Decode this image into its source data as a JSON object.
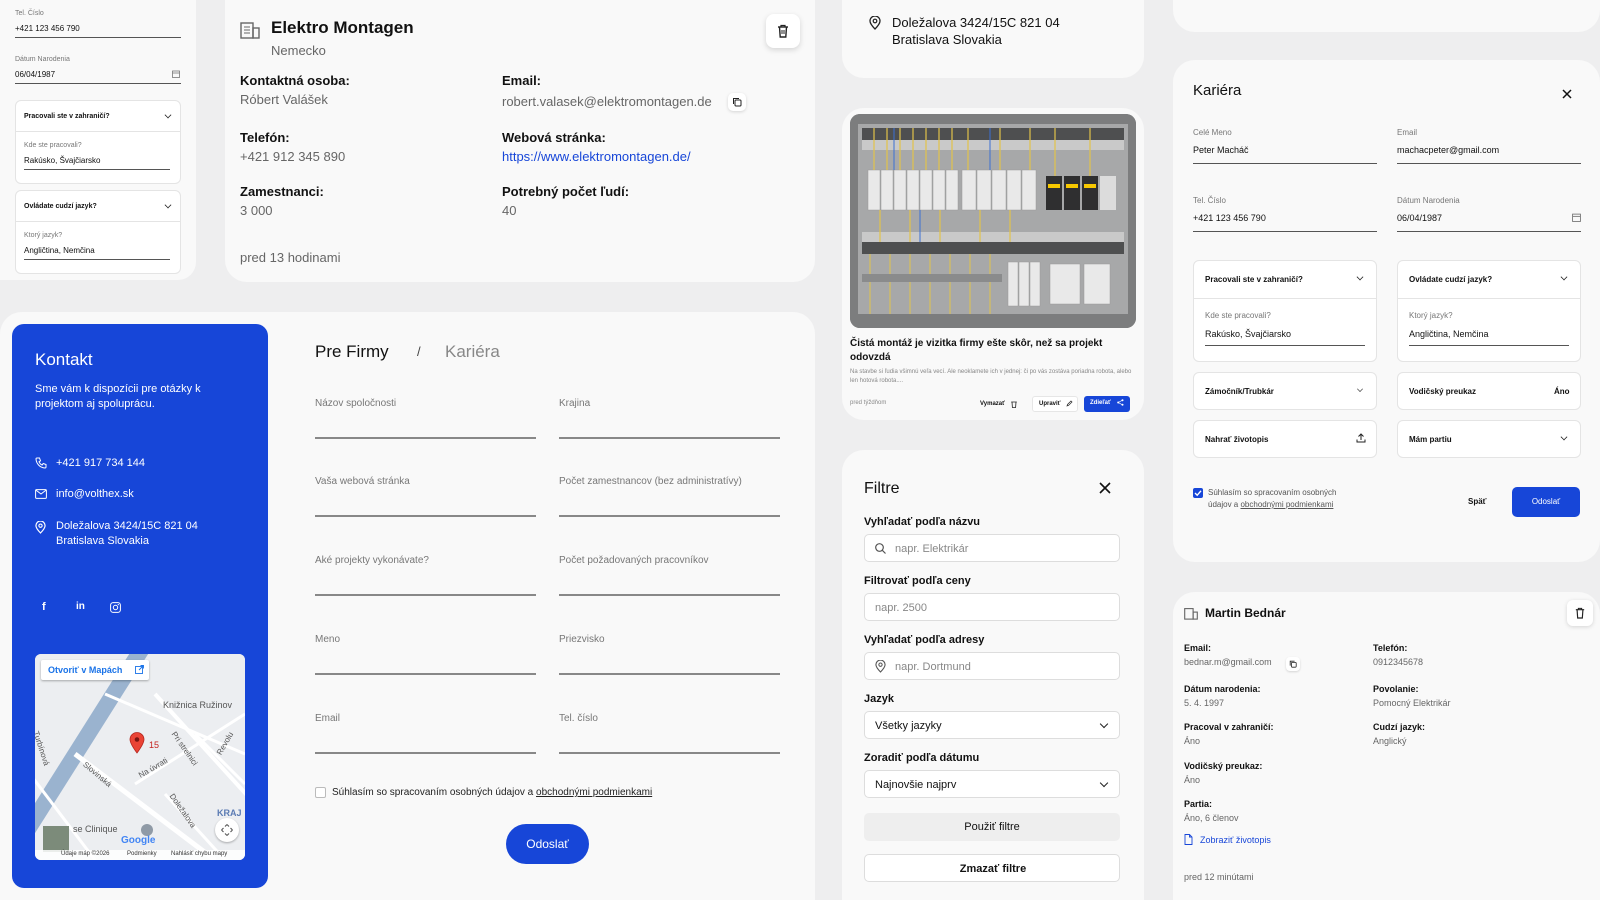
{
  "colors": {
    "primary": "#1746d8",
    "link": "#1746d8",
    "background": "#eeeeef",
    "card": "#f9f9f9"
  },
  "mini_form": {
    "phone_label": "Tel. Číslo",
    "phone_value": "+421 123 456 790",
    "birth_label": "Dátum Narodenia",
    "birth_value": "06/04/1987",
    "abroad_q": "Pracovali ste v zahraničí?",
    "abroad_where_label": "Kde ste pracovali?",
    "abroad_where_value": "Rakúsko, Švajčiarsko",
    "lang_q": "Ovládate cudzí jazyk?",
    "lang_which_label": "Ktorý jazyk?",
    "lang_which_value": "Angličtina, Nemčina"
  },
  "company_card": {
    "name": "Elektro Montagen",
    "country": "Nemecko",
    "contact_label": "Kontaktná osoba:",
    "contact_value": "Róbert Valášek",
    "email_label": "Email:",
    "email_value": "robert.valasek@elektromontagen.de",
    "phone_label": "Telefón:",
    "phone_value": "+421 912 345 890",
    "web_label": "Webová stránka:",
    "web_value": "https://www.elektromontagen.de/",
    "employees_label": "Zamestnanci:",
    "employees_value": "3 000",
    "needed_label": "Potrebný počet ľudí:",
    "needed_value": "40",
    "time": "pred 13 hodinami"
  },
  "address_card": {
    "line1": "Doležalova 3424/15C 821 04",
    "line2": "Bratislava Slovakia"
  },
  "article_card": {
    "title": "Čistá montáž je vizitka firmy ešte skôr, než sa projekt odovzdá",
    "excerpt": "Na stavbe si ľudia všimnú veľa vecí. Ale neoklamete ich v jednej: či po vás zostáva poriadna robota, alebo len hotová robota....",
    "time": "pred týždňom",
    "delete": "Vymazať",
    "edit": "Upraviť",
    "share": "Zdieľať"
  },
  "contact_panel": {
    "title": "Kontakt",
    "subtitle": "Sme vám k dispozícii pre otázky k projektom aj spoluprácu.",
    "phone": "+421 917 734 144",
    "email": "info@volthex.sk",
    "address_line1": "Doležalova 3424/15C 821 04",
    "address_line2": "Bratislava Slovakia",
    "map": {
      "open_label": "Otvoriť v Mapách",
      "place1": "Knižnica Ružinov",
      "street1": "Turbínová",
      "street2": "Slovinská",
      "street3": "Na úvrati",
      "street4": "Pri strelnici",
      "street5": "Doležalova",
      "street6": "Revolu",
      "marker_num": "15",
      "place2": "se Clinique",
      "kraj": "KRAJ",
      "google": "Google",
      "footer_data": "Údaje máp ©2026",
      "footer_terms": "Podmienky",
      "footer_report": "Nahlásiť chybu mapy"
    }
  },
  "main_form": {
    "tab1": "Pre Firmy",
    "sep": "/",
    "tab2": "Kariéra",
    "f1": "Názov spoločnosti",
    "f2": "Krajina",
    "f3": "Vaša webová stránka",
    "f4": "Počet zamestnancov (bez administratívy)",
    "f5": "Aké projekty vykonávate?",
    "f6": "Počet požadovaných pracovníkov",
    "f7": "Meno",
    "f8": "Priezvisko",
    "f9": "Email",
    "f10": "Tel. číslo",
    "consent_text": "Súhlasím so spracovaním osobných údajov a",
    "consent_link": "obchodnými podmienkami",
    "submit": "Odoslať"
  },
  "filters": {
    "title": "Filtre",
    "name_label": "Vyhľadať podľa názvu",
    "name_placeholder": "napr. Elektrikár",
    "price_label": "Filtrovať podľa ceny",
    "price_placeholder": "napr. 2500",
    "address_label": "Vyhľadať podľa adresy",
    "address_placeholder": "napr. Dortmund",
    "lang_label": "Jazyk",
    "lang_value": "Všetky jazyky",
    "sort_label": "Zoradiť podľa dátumu",
    "sort_value": "Najnovšie najprv",
    "apply": "Použiť filtre",
    "clear": "Zmazať filtre"
  },
  "career_modal": {
    "title": "Kariéra",
    "name_label": "Celé Meno",
    "name_value": "Peter Macháč",
    "email_label": "Email",
    "email_value": "machacpeter@gmail.com",
    "phone_label": "Tel. Číslo",
    "phone_value": "+421 123 456 790",
    "birth_label": "Dátum Narodenia",
    "birth_value": "06/04/1987",
    "abroad_q": "Pracovali ste v zahraničí?",
    "abroad_where_label": "Kde ste pracovali?",
    "abroad_where_value": "Rakúsko, Švajčiarsko",
    "lang_q": "Ovládate cudzí jazyk?",
    "lang_which_label": "Ktorý jazyk?",
    "lang_which_value": "Angličtina, Nemčina",
    "profession": "Zámočník/Trubkár",
    "license_label": "Vodičský preukaz",
    "license_value": "Áno",
    "cv": "Nahrať životopis",
    "team": "Mám partiu",
    "consent_text": "Súhlasím so spracovaním osobných údajov a",
    "consent_link": "obchodnými podmienkami",
    "back": "Späť",
    "submit": "Odoslať"
  },
  "worker_card": {
    "name": "Martin Bednár",
    "email_label": "Email:",
    "email_value": "bednar.m@gmail.com",
    "phone_label": "Telefón:",
    "phone_value": "0912345678",
    "birth_label": "Dátum narodenia:",
    "birth_value": "5. 4. 1997",
    "job_label": "Povolanie:",
    "job_value": "Pomocný Elektrikár",
    "abroad_label": "Pracoval v zahraničí:",
    "abroad_value": "Áno",
    "lang_label": "Cudzí jazyk:",
    "lang_value": "Anglický",
    "license_label": "Vodičský preukaz:",
    "license_value": "Áno",
    "team_label": "Partia:",
    "team_value": "Áno, 6 členov",
    "cv_link": "Zobraziť životopis",
    "time": "pred 12 minútami"
  }
}
